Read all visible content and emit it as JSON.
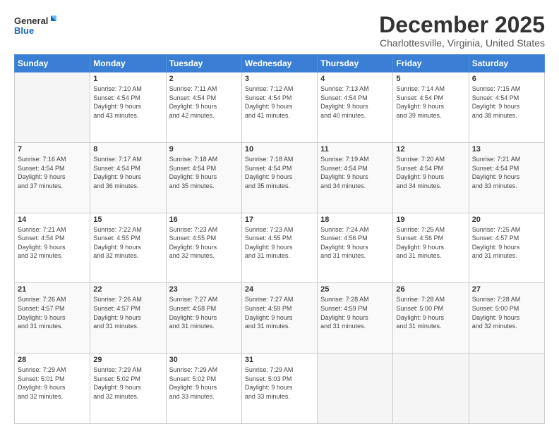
{
  "logo": {
    "line1": "General",
    "line2": "Blue"
  },
  "header": {
    "month": "December 2025",
    "location": "Charlottesville, Virginia, United States"
  },
  "weekdays": [
    "Sunday",
    "Monday",
    "Tuesday",
    "Wednesday",
    "Thursday",
    "Friday",
    "Saturday"
  ],
  "weeks": [
    [
      {
        "day": "",
        "info": ""
      },
      {
        "day": "1",
        "info": "Sunrise: 7:10 AM\nSunset: 4:54 PM\nDaylight: 9 hours\nand 43 minutes."
      },
      {
        "day": "2",
        "info": "Sunrise: 7:11 AM\nSunset: 4:54 PM\nDaylight: 9 hours\nand 42 minutes."
      },
      {
        "day": "3",
        "info": "Sunrise: 7:12 AM\nSunset: 4:54 PM\nDaylight: 9 hours\nand 41 minutes."
      },
      {
        "day": "4",
        "info": "Sunrise: 7:13 AM\nSunset: 4:54 PM\nDaylight: 9 hours\nand 40 minutes."
      },
      {
        "day": "5",
        "info": "Sunrise: 7:14 AM\nSunset: 4:54 PM\nDaylight: 9 hours\nand 39 minutes."
      },
      {
        "day": "6",
        "info": "Sunrise: 7:15 AM\nSunset: 4:54 PM\nDaylight: 9 hours\nand 38 minutes."
      }
    ],
    [
      {
        "day": "7",
        "info": "Sunrise: 7:16 AM\nSunset: 4:54 PM\nDaylight: 9 hours\nand 37 minutes."
      },
      {
        "day": "8",
        "info": "Sunrise: 7:17 AM\nSunset: 4:54 PM\nDaylight: 9 hours\nand 36 minutes."
      },
      {
        "day": "9",
        "info": "Sunrise: 7:18 AM\nSunset: 4:54 PM\nDaylight: 9 hours\nand 35 minutes."
      },
      {
        "day": "10",
        "info": "Sunrise: 7:18 AM\nSunset: 4:54 PM\nDaylight: 9 hours\nand 35 minutes."
      },
      {
        "day": "11",
        "info": "Sunrise: 7:19 AM\nSunset: 4:54 PM\nDaylight: 9 hours\nand 34 minutes."
      },
      {
        "day": "12",
        "info": "Sunrise: 7:20 AM\nSunset: 4:54 PM\nDaylight: 9 hours\nand 34 minutes."
      },
      {
        "day": "13",
        "info": "Sunrise: 7:21 AM\nSunset: 4:54 PM\nDaylight: 9 hours\nand 33 minutes."
      }
    ],
    [
      {
        "day": "14",
        "info": "Sunrise: 7:21 AM\nSunset: 4:54 PM\nDaylight: 9 hours\nand 32 minutes."
      },
      {
        "day": "15",
        "info": "Sunrise: 7:22 AM\nSunset: 4:55 PM\nDaylight: 9 hours\nand 32 minutes."
      },
      {
        "day": "16",
        "info": "Sunrise: 7:23 AM\nSunset: 4:55 PM\nDaylight: 9 hours\nand 32 minutes."
      },
      {
        "day": "17",
        "info": "Sunrise: 7:23 AM\nSunset: 4:55 PM\nDaylight: 9 hours\nand 31 minutes."
      },
      {
        "day": "18",
        "info": "Sunrise: 7:24 AM\nSunset: 4:56 PM\nDaylight: 9 hours\nand 31 minutes."
      },
      {
        "day": "19",
        "info": "Sunrise: 7:25 AM\nSunset: 4:56 PM\nDaylight: 9 hours\nand 31 minutes."
      },
      {
        "day": "20",
        "info": "Sunrise: 7:25 AM\nSunset: 4:57 PM\nDaylight: 9 hours\nand 31 minutes."
      }
    ],
    [
      {
        "day": "21",
        "info": "Sunrise: 7:26 AM\nSunset: 4:57 PM\nDaylight: 9 hours\nand 31 minutes."
      },
      {
        "day": "22",
        "info": "Sunrise: 7:26 AM\nSunset: 4:57 PM\nDaylight: 9 hours\nand 31 minutes."
      },
      {
        "day": "23",
        "info": "Sunrise: 7:27 AM\nSunset: 4:58 PM\nDaylight: 9 hours\nand 31 minutes."
      },
      {
        "day": "24",
        "info": "Sunrise: 7:27 AM\nSunset: 4:59 PM\nDaylight: 9 hours\nand 31 minutes."
      },
      {
        "day": "25",
        "info": "Sunrise: 7:28 AM\nSunset: 4:59 PM\nDaylight: 9 hours\nand 31 minutes."
      },
      {
        "day": "26",
        "info": "Sunrise: 7:28 AM\nSunset: 5:00 PM\nDaylight: 9 hours\nand 31 minutes."
      },
      {
        "day": "27",
        "info": "Sunrise: 7:28 AM\nSunset: 5:00 PM\nDaylight: 9 hours\nand 32 minutes."
      }
    ],
    [
      {
        "day": "28",
        "info": "Sunrise: 7:29 AM\nSunset: 5:01 PM\nDaylight: 9 hours\nand 32 minutes."
      },
      {
        "day": "29",
        "info": "Sunrise: 7:29 AM\nSunset: 5:02 PM\nDaylight: 9 hours\nand 32 minutes."
      },
      {
        "day": "30",
        "info": "Sunrise: 7:29 AM\nSunset: 5:02 PM\nDaylight: 9 hours\nand 33 minutes."
      },
      {
        "day": "31",
        "info": "Sunrise: 7:29 AM\nSunset: 5:03 PM\nDaylight: 9 hours\nand 33 minutes."
      },
      {
        "day": "",
        "info": ""
      },
      {
        "day": "",
        "info": ""
      },
      {
        "day": "",
        "info": ""
      }
    ]
  ]
}
